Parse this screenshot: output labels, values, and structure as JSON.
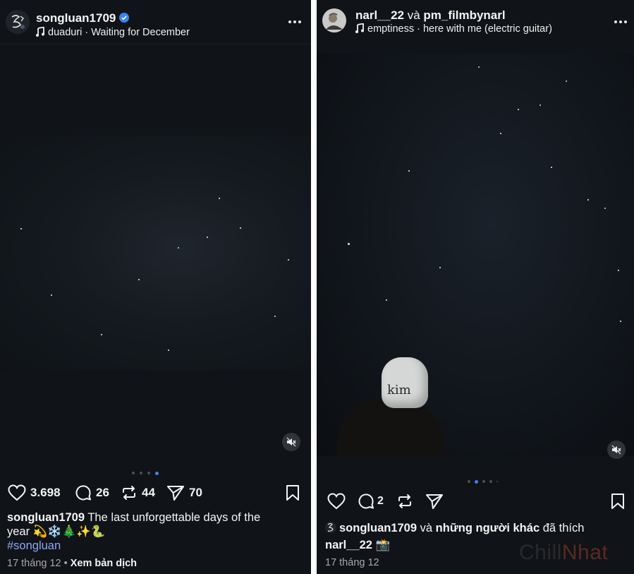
{
  "left_post": {
    "username": "songluan1709",
    "music_artist": "duaduri",
    "music_separator": " · ",
    "music_title": "Waiting for December",
    "stats": {
      "likes": "3.698",
      "comments": "26",
      "reposts": "44",
      "shares": "70"
    },
    "caption": {
      "author": "songluan1709",
      "text": " The last unforgettable days of the",
      "text_line2": "year",
      "emojis": "💫❄️🎄✨🐍",
      "hashtag": "#songluan"
    },
    "date": "17 tháng 12",
    "dot_separator": " • ",
    "translate_label": "Xem bản dịch",
    "carousel": {
      "count": 4,
      "active": 4
    }
  },
  "right_post": {
    "user1": "narl__22",
    "joiner": " và ",
    "user2": "pm_filmbynarl",
    "music_artist": "emptiness",
    "music_separator": " · ",
    "music_title": "here with me (electric guitar)",
    "hat_text": "kim",
    "stats": {
      "comments": "2"
    },
    "liked_by": {
      "name": "songluan1709",
      "joiner": " và ",
      "others": "những người khác",
      "suffix": " đã thích"
    },
    "caption": {
      "author": "narl__22",
      "emoji": "📸"
    },
    "date": "17 tháng 12",
    "carousel": {
      "count": 5,
      "active": 2
    }
  },
  "watermark": {
    "part1": "Chill",
    "part2": "Nhat"
  },
  "colors": {
    "background": "#101318",
    "accent_blue": "#3b82f6",
    "hashtag": "#8da6f7",
    "muted_text": "#a8a8a8"
  }
}
